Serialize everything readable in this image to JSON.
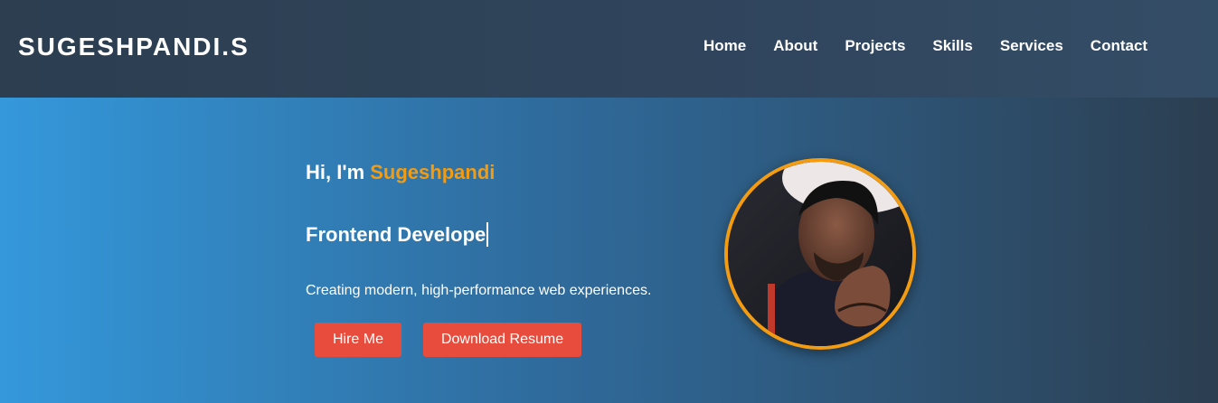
{
  "header": {
    "logo": "SUGESHPANDI.S",
    "nav": [
      {
        "label": "Home"
      },
      {
        "label": "About"
      },
      {
        "label": "Projects"
      },
      {
        "label": "Skills"
      },
      {
        "label": "Services"
      },
      {
        "label": "Contact"
      }
    ]
  },
  "hero": {
    "greeting_prefix": "Hi, I'm ",
    "greeting_name": "Sugeshpandi",
    "role_typed": "Frontend Develope",
    "tagline": "Creating modern, high-performance web experiences.",
    "buttons": {
      "hire": "Hire Me",
      "resume": "Download Resume"
    },
    "avatar_icon": "profile-photo"
  },
  "colors": {
    "header_bg": "#2c3e50",
    "hero_gradient_start": "#3498db",
    "hero_gradient_end": "#2c3e50",
    "accent": "#f39c12",
    "button": "#e74c3c"
  }
}
